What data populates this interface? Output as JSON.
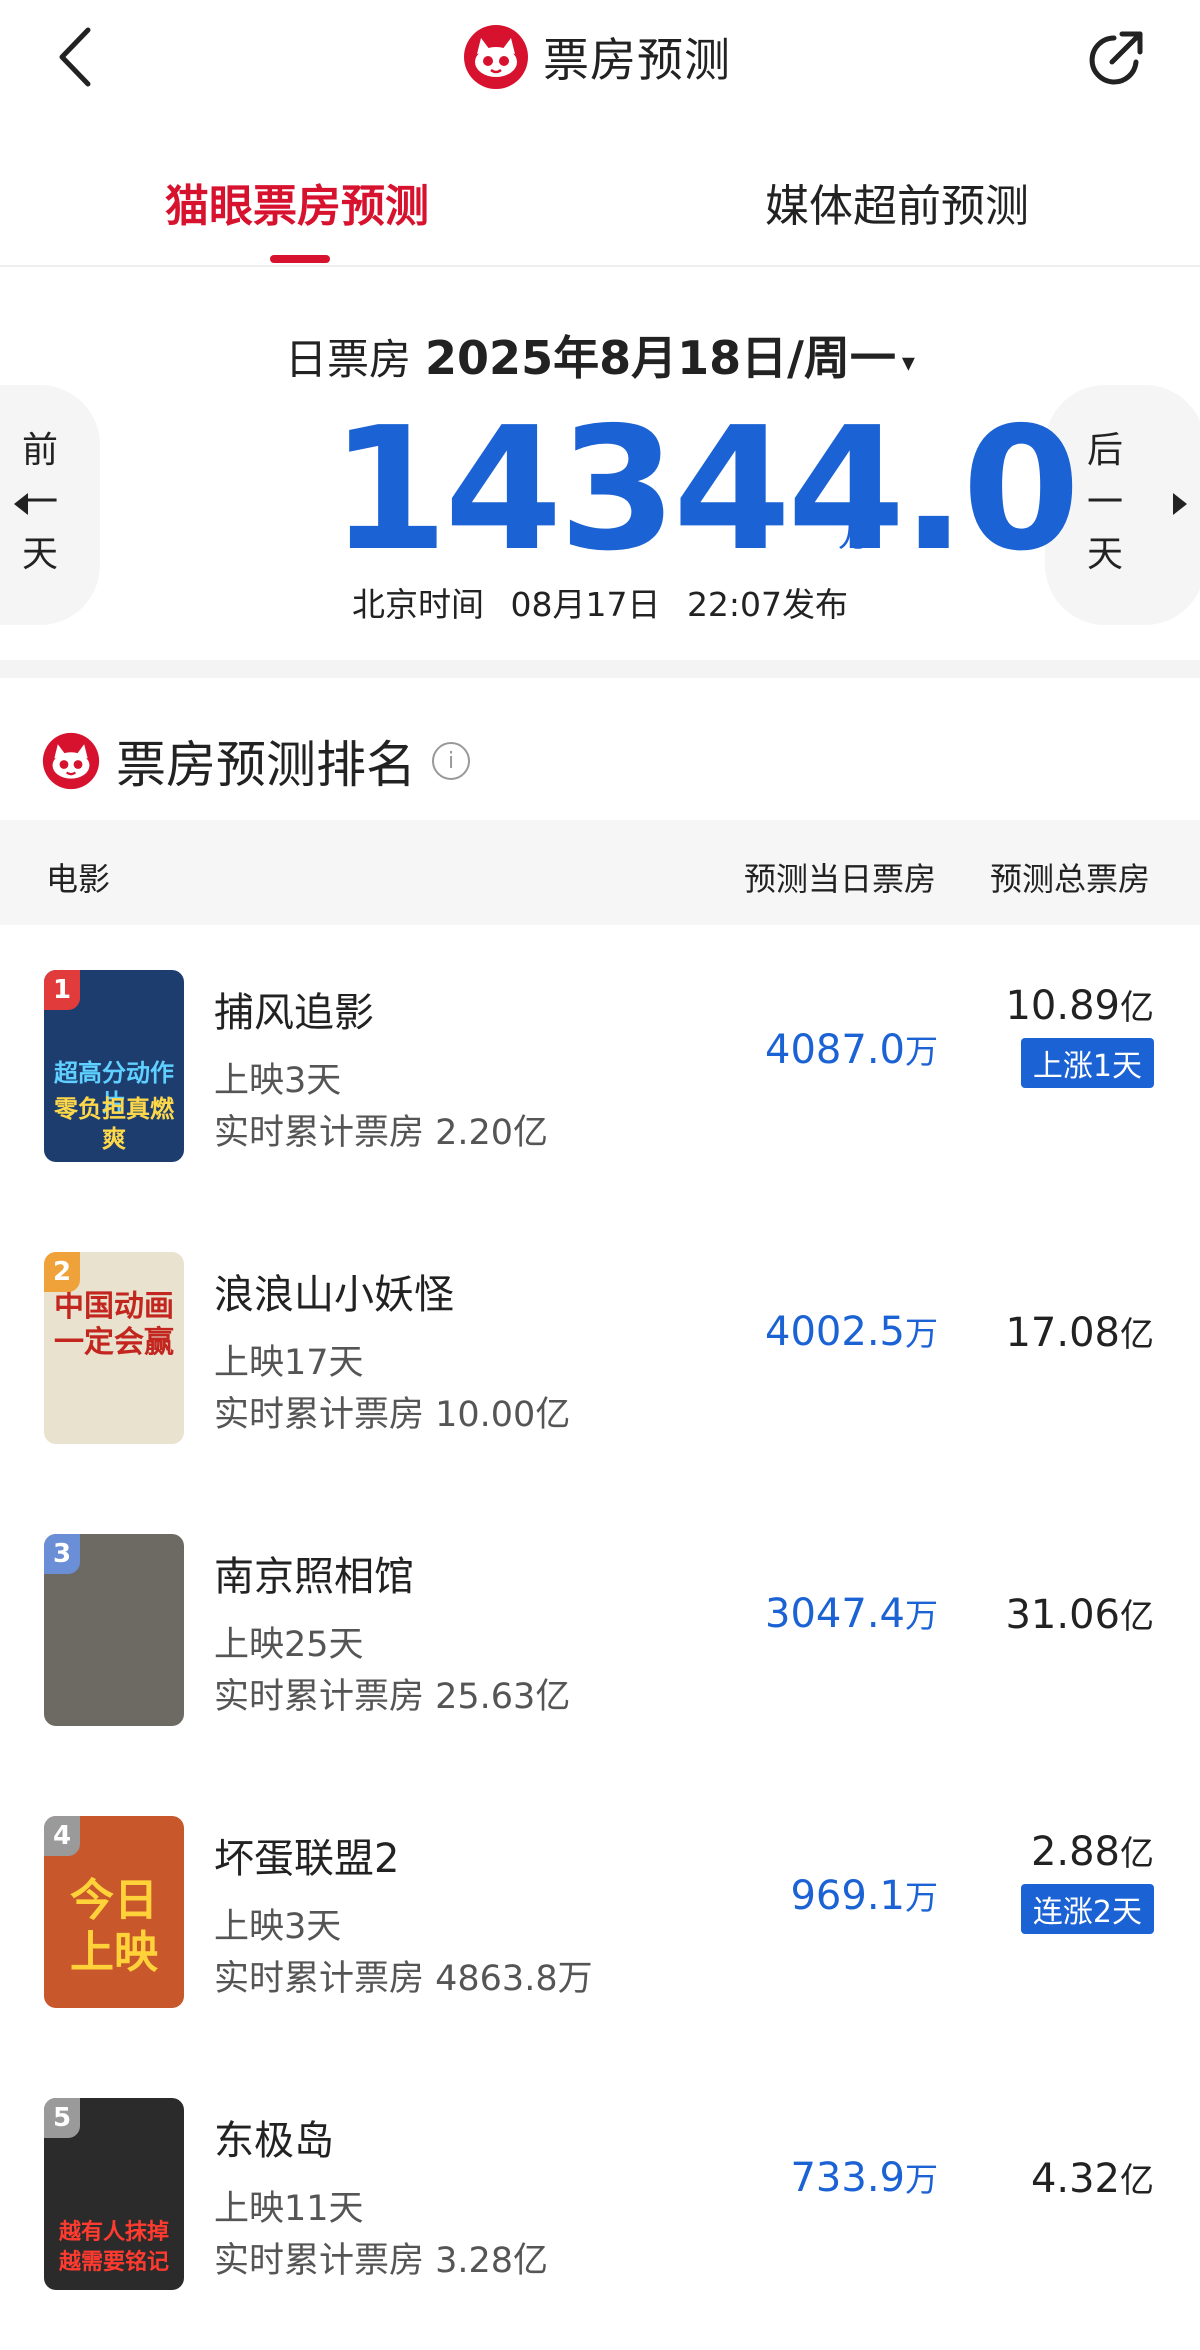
{
  "header": {
    "title": "票房预测",
    "back_icon": "chevron-left-icon",
    "share_icon": "share-icon",
    "brand_color": "#d7122f"
  },
  "tabs": [
    {
      "label": "猫眼票房预测",
      "active": true
    },
    {
      "label": "媒体超前预测",
      "active": false
    }
  ],
  "day": {
    "label": "日票房",
    "date": "2025年8月18日/周一",
    "caret": "▾",
    "value": "14344.0",
    "unit": "万",
    "prev_label": [
      "前",
      "一",
      "天"
    ],
    "next_label": [
      "后",
      "一",
      "天"
    ],
    "publish": {
      "zone": "北京时间",
      "date": "08月17日",
      "time": "22:07发布"
    }
  },
  "ranking": {
    "title": "票房预测排名",
    "info_icon": "info-icon",
    "columns": [
      "电影",
      "预测当日票房",
      "预测总票房"
    ],
    "rows": [
      {
        "rank": "1",
        "title": "捕风追影",
        "days": "上映3天",
        "realtime": "实时累计票房 2.20亿",
        "daily": "4087.0",
        "daily_unit": "万",
        "pred": "10.89",
        "pred_unit": "亿",
        "tag": "上涨1天",
        "poster_text": [
          "超高分动作片",
          "零负担真燃爽"
        ],
        "poster_color": "#1c3d6e",
        "badge_color": "#e23b3b"
      },
      {
        "rank": "2",
        "title": "浪浪山小妖怪",
        "days": "上映17天",
        "realtime": "实时累计票房 10.00亿",
        "daily": "4002.5",
        "daily_unit": "万",
        "pred": "17.08",
        "pred_unit": "亿",
        "tag": "",
        "poster_text": [
          "中国动画",
          "一定会赢"
        ],
        "poster_color": "#e8e2cf",
        "badge_color": "#f0a23a"
      },
      {
        "rank": "3",
        "title": "南京照相馆",
        "days": "上映25天",
        "realtime": "实时累计票房 25.63亿",
        "daily": "3047.4",
        "daily_unit": "万",
        "pred": "31.06",
        "pred_unit": "亿",
        "tag": "",
        "poster_text": [
          "",
          ""
        ],
        "poster_color": "#6d6a64",
        "badge_color": "#6b8fd6"
      },
      {
        "rank": "4",
        "title": "坏蛋联盟2",
        "days": "上映3天",
        "realtime": "实时累计票房 4863.8万",
        "daily": "969.1",
        "daily_unit": "万",
        "pred": "2.88",
        "pred_unit": "亿",
        "tag": "连涨2天",
        "poster_text": [
          "今日",
          "上映"
        ],
        "poster_color": "#c9572c",
        "badge_color": "#9a9a9a"
      },
      {
        "rank": "5",
        "title": "东极岛",
        "days": "上映11天",
        "realtime": "实时累计票房 3.28亿",
        "daily": "733.9",
        "daily_unit": "万",
        "pred": "4.32",
        "pred_unit": "亿",
        "tag": "",
        "poster_text": [
          "越有人抹掉",
          "越需要铭记"
        ],
        "poster_color": "#2b2b2b",
        "badge_color": "#9a9a9a"
      }
    ]
  }
}
